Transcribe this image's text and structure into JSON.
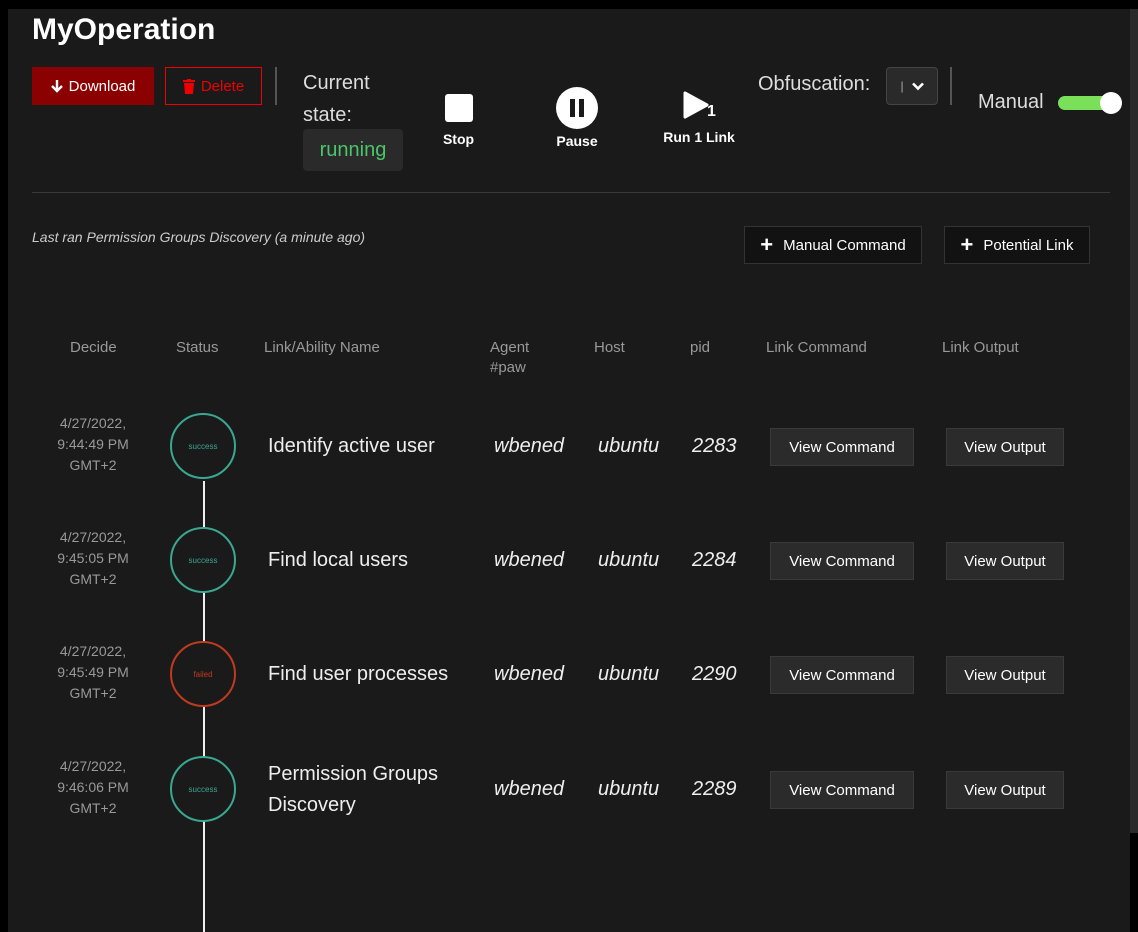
{
  "operation": {
    "title": "MyOperation",
    "download_label": "Download",
    "delete_label": "Delete",
    "state_label_line1": "Current",
    "state_label_line2": "state:",
    "state_value": "running",
    "stop_label": "Stop",
    "pause_label": "Pause",
    "run_label": "Run 1 Link",
    "run_badge": "1",
    "obfuscation_label": "Obfuscation:",
    "obfuscation_value": "|",
    "manual_label": "Manual",
    "manual_on": true
  },
  "actions": {
    "last_ran": "Last ran Permission Groups Discovery (a minute ago)",
    "manual_command_label": "Manual Command",
    "potential_link_label": "Potential Link"
  },
  "table": {
    "headers": {
      "decide": "Decide",
      "status": "Status",
      "name": "Link/Ability Name",
      "agent_line1": "Agent",
      "agent_line2": "#paw",
      "host": "Host",
      "pid": "pid",
      "command": "Link Command",
      "output": "Link Output"
    },
    "rows": [
      {
        "date1": "4/27/2022,",
        "date2": "9:44:49 PM",
        "date3": "GMT+2",
        "status": "success",
        "name1": "Identify active user",
        "name2": "",
        "agent": "wbened",
        "host": "ubuntu",
        "pid": "2283",
        "command_btn": "View Command",
        "output_btn": "View Output"
      },
      {
        "date1": "4/27/2022,",
        "date2": "9:45:05 PM",
        "date3": "GMT+2",
        "status": "success",
        "name1": "Find local users",
        "name2": "",
        "agent": "wbened",
        "host": "ubuntu",
        "pid": "2284",
        "command_btn": "View Command",
        "output_btn": "View Output"
      },
      {
        "date1": "4/27/2022,",
        "date2": "9:45:49 PM",
        "date3": "GMT+2",
        "status": "failed",
        "name1": "Find user processes",
        "name2": "",
        "agent": "wbened",
        "host": "ubuntu",
        "pid": "2290",
        "command_btn": "View Command",
        "output_btn": "View Output"
      },
      {
        "date1": "4/27/2022,",
        "date2": "9:46:06 PM",
        "date3": "GMT+2",
        "status": "success",
        "name1": "Permission Groups",
        "name2": "Discovery",
        "agent": "wbened",
        "host": "ubuntu",
        "pid": "2289",
        "command_btn": "View Command",
        "output_btn": "View Output"
      }
    ]
  },
  "colors": {
    "success": "#3aa890",
    "failed": "#c03a1e",
    "running": "#4cc46a",
    "download_bg": "#8b0000",
    "delete_border": "#e00000",
    "toggle_track": "#7ae05a"
  },
  "icons": {
    "download": "arrow-down-icon",
    "delete": "trash-icon",
    "stop": "stop-square-icon",
    "pause": "pause-circle-icon",
    "run": "play-icon",
    "dropdown": "chevron-down-icon",
    "add": "plus-icon"
  }
}
